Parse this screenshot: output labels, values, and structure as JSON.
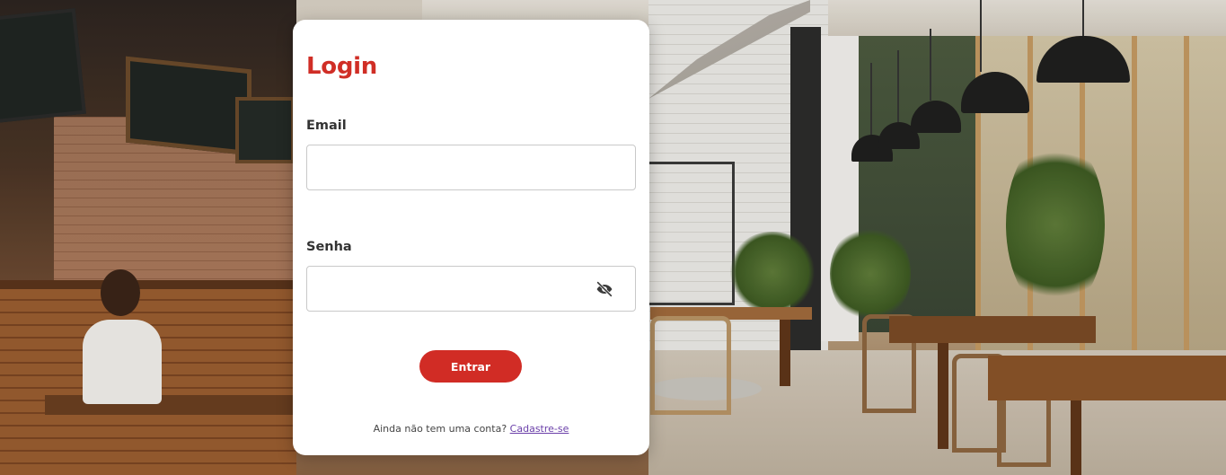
{
  "login": {
    "title": "Login",
    "email_label": "Email",
    "email_value": "",
    "password_label": "Senha",
    "password_value": "",
    "submit_label": "Entrar",
    "signup_prompt": "Ainda não tem uma conta?",
    "signup_link": "Cadastre-se"
  },
  "icons": {
    "password_toggle": "eye-off-icon"
  },
  "colors": {
    "accent": "#d02e26",
    "button": "#d12c25",
    "link": "#6a3fa9",
    "card_background": "#ffffff"
  }
}
